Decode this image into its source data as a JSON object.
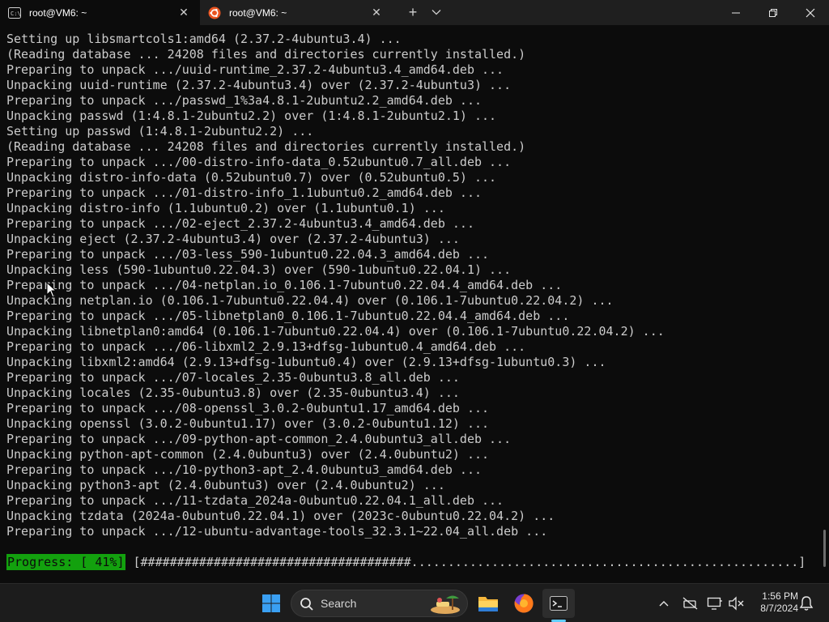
{
  "tabs": [
    {
      "title": "root@VM6: ~",
      "icon": "terminal-icon",
      "active": true
    },
    {
      "title": "root@VM6: ~",
      "icon": "ubuntu-icon",
      "active": false
    }
  ],
  "window_controls": {
    "new_tab": "+",
    "tab_menu": "chevron-down-icon",
    "minimize": "minimize-icon",
    "maximize": "maximize-icon",
    "close": "close-icon"
  },
  "terminal": {
    "lines": [
      "Setting up libsmartcols1:amd64 (2.37.2-4ubuntu3.4) ...",
      "(Reading database ... 24208 files and directories currently installed.)",
      "Preparing to unpack .../uuid-runtime_2.37.2-4ubuntu3.4_amd64.deb ...",
      "Unpacking uuid-runtime (2.37.2-4ubuntu3.4) over (2.37.2-4ubuntu3) ...",
      "Preparing to unpack .../passwd_1%3a4.8.1-2ubuntu2.2_amd64.deb ...",
      "Unpacking passwd (1:4.8.1-2ubuntu2.2) over (1:4.8.1-2ubuntu2.1) ...",
      "Setting up passwd (1:4.8.1-2ubuntu2.2) ...",
      "(Reading database ... 24208 files and directories currently installed.)",
      "Preparing to unpack .../00-distro-info-data_0.52ubuntu0.7_all.deb ...",
      "Unpacking distro-info-data (0.52ubuntu0.7) over (0.52ubuntu0.5) ...",
      "Preparing to unpack .../01-distro-info_1.1ubuntu0.2_amd64.deb ...",
      "Unpacking distro-info (1.1ubuntu0.2) over (1.1ubuntu0.1) ...",
      "Preparing to unpack .../02-eject_2.37.2-4ubuntu3.4_amd64.deb ...",
      "Unpacking eject (2.37.2-4ubuntu3.4) over (2.37.2-4ubuntu3) ...",
      "Preparing to unpack .../03-less_590-1ubuntu0.22.04.3_amd64.deb ...",
      "Unpacking less (590-1ubuntu0.22.04.3) over (590-1ubuntu0.22.04.1) ...",
      "Preparing to unpack .../04-netplan.io_0.106.1-7ubuntu0.22.04.4_amd64.deb ...",
      "Unpacking netplan.io (0.106.1-7ubuntu0.22.04.4) over (0.106.1-7ubuntu0.22.04.2) ...",
      "Preparing to unpack .../05-libnetplan0_0.106.1-7ubuntu0.22.04.4_amd64.deb ...",
      "Unpacking libnetplan0:amd64 (0.106.1-7ubuntu0.22.04.4) over (0.106.1-7ubuntu0.22.04.2) ...",
      "Preparing to unpack .../06-libxml2_2.9.13+dfsg-1ubuntu0.4_amd64.deb ...",
      "Unpacking libxml2:amd64 (2.9.13+dfsg-1ubuntu0.4) over (2.9.13+dfsg-1ubuntu0.3) ...",
      "Preparing to unpack .../07-locales_2.35-0ubuntu3.8_all.deb ...",
      "Unpacking locales (2.35-0ubuntu3.8) over (2.35-0ubuntu3.4) ...",
      "Preparing to unpack .../08-openssl_3.0.2-0ubuntu1.17_amd64.deb ...",
      "Unpacking openssl (3.0.2-0ubuntu1.17) over (3.0.2-0ubuntu1.12) ...",
      "Preparing to unpack .../09-python-apt-common_2.4.0ubuntu3_all.deb ...",
      "Unpacking python-apt-common (2.4.0ubuntu3) over (2.4.0ubuntu2) ...",
      "Preparing to unpack .../10-python3-apt_2.4.0ubuntu3_amd64.deb ...",
      "Unpacking python3-apt (2.4.0ubuntu3) over (2.4.0ubuntu2) ...",
      "Preparing to unpack .../11-tzdata_2024a-0ubuntu0.22.04.1_all.deb ...",
      "Unpacking tzdata (2024a-0ubuntu0.22.04.1) over (2023c-0ubuntu0.22.04.2) ...",
      "Preparing to unpack .../12-ubuntu-advantage-tools_32.3.1~22.04_all.deb ..."
    ],
    "progress": {
      "label": "Progress: [ 41%]",
      "percent": 41,
      "bar": "[#####################################.....................................................]"
    },
    "colors": {
      "background": "#0c0c0c",
      "text": "#cccccc",
      "progress_bg": "#13a10e"
    }
  },
  "taskbar": {
    "search_placeholder": "Search",
    "apps": [
      "windows-start-icon",
      "file-explorer-icon",
      "firefox-icon",
      "terminal-icon"
    ],
    "tray_icons": [
      "chevron-up-icon",
      "network-off-icon",
      "display-icon",
      "volume-muted-icon",
      "bell-icon"
    ],
    "time": "1:56 PM",
    "date": "8/7/2024"
  }
}
